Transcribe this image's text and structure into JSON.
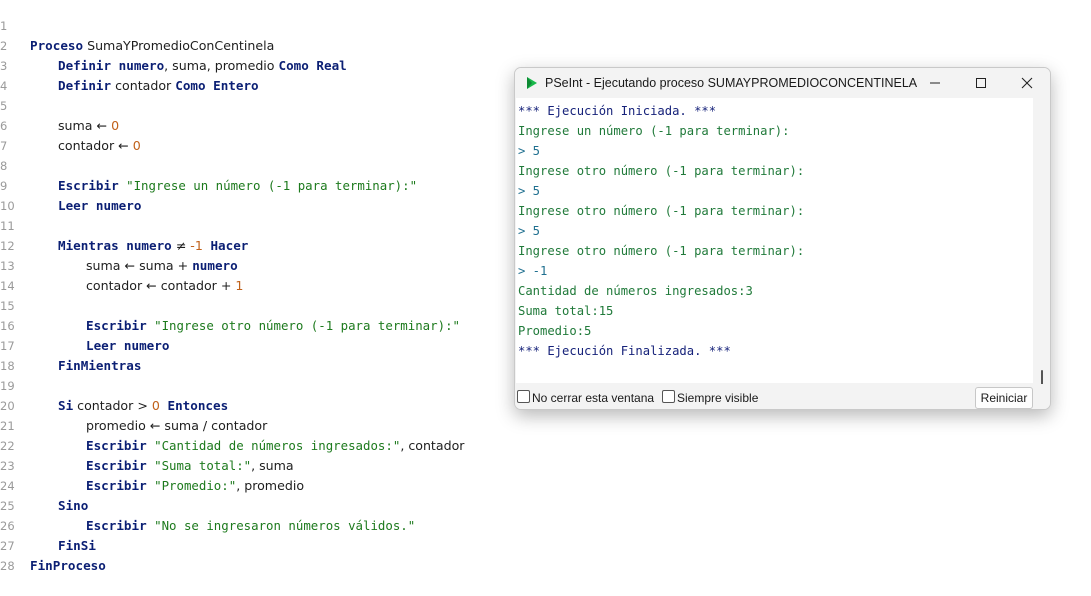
{
  "editor": {
    "line_numbers": [
      "1",
      "2",
      "3",
      "4",
      "5",
      "6",
      "7",
      "8",
      "9",
      "10",
      "11",
      "12",
      "13",
      "14",
      "15",
      "16",
      "17",
      "18",
      "19",
      "20",
      "21",
      "22",
      "23",
      "24",
      "25",
      "26",
      "27",
      "28"
    ],
    "lines": {
      "l1": {
        "kw1": "Proceso",
        "id": " SumaYPromedioConCentinela"
      },
      "l2": {
        "kw1": "Definir",
        "idb": " numero",
        "rest": ", suma, promedio ",
        "kw2": "Como Real"
      },
      "l3": {
        "kw1": "Definir",
        "rest": " contador ",
        "kw2": "Como Entero"
      },
      "l5": {
        "id": "suma ",
        "op": "← ",
        "num": "0"
      },
      "l6": {
        "id": "contador ",
        "op": "← ",
        "num": "0"
      },
      "l8": {
        "kw1": "Escribir",
        "str": " \"Ingrese un número (-1 para terminar):\""
      },
      "l9": {
        "kw1": "Leer numero"
      },
      "l11": {
        "kw1": "Mientras numero",
        "op": " ≠ ",
        "num": "-1",
        "kw2": " Hacer"
      },
      "l12": {
        "id": "suma ",
        "op": "← ",
        "id2": "suma + ",
        "idb": "numero"
      },
      "l13": {
        "id": "contador ",
        "op": "← ",
        "id2": "contador + ",
        "num": "1"
      },
      "l15": {
        "kw1": "Escribir",
        "str": " \"Ingrese otro número (-1 para terminar):\""
      },
      "l16": {
        "kw1": "Leer numero"
      },
      "l17": {
        "kw1": "FinMientras"
      },
      "l19": {
        "kw1": "Si",
        "id": " contador > ",
        "num": "0",
        "kw2": " Entonces"
      },
      "l20": {
        "id": "promedio ",
        "op": "← ",
        "id2": "suma / contador"
      },
      "l21": {
        "kw1": "Escribir",
        "str": " \"Cantidad de números ingresados:\"",
        "id": ", contador"
      },
      "l22": {
        "kw1": "Escribir",
        "str": " \"Suma total:\"",
        "id": ", suma"
      },
      "l23": {
        "kw1": "Escribir",
        "str": " \"Promedio:\"",
        "id": ", promedio"
      },
      "l24": {
        "kw1": "Sino"
      },
      "l25": {
        "kw1": "Escribir",
        "str": " \"No se ingresaron números válidos.\""
      },
      "l26": {
        "kw1": "FinSi"
      },
      "l27": {
        "kw1": "FinProceso"
      }
    }
  },
  "window": {
    "title": "PSeInt - Ejecutando proceso SUMAYPROMEDIOCONCENTINELA",
    "icon": "pseint-logo-icon",
    "controls": [
      "minimize-icon",
      "maximize-icon",
      "close-icon"
    ],
    "console_lines": [
      "*** Ejecución Iniciada. ***",
      "Ingrese un número (-1 para terminar):",
      "> 5",
      "Ingrese otro número (-1 para terminar):",
      "> 5",
      "Ingrese otro número (-1 para terminar):",
      "> 5",
      "Ingrese otro número (-1 para terminar):",
      "> -1",
      "Cantidad de números ingresados:3",
      "Suma total:15",
      "Promedio:5",
      "*** Ejecución Finalizada. ***"
    ],
    "no_close_label": "No cerrar esta ventana",
    "always_visible_label": "Siempre visible",
    "restart_label": "Reiniciar"
  },
  "colors": {
    "keyword": "#0b1f74",
    "string": "#1d7a1d",
    "number": "#c0611a",
    "console_system": "#16227a",
    "console_output": "#207a3a",
    "console_input": "#1f6f8f",
    "logo_green": "#18b84a"
  }
}
